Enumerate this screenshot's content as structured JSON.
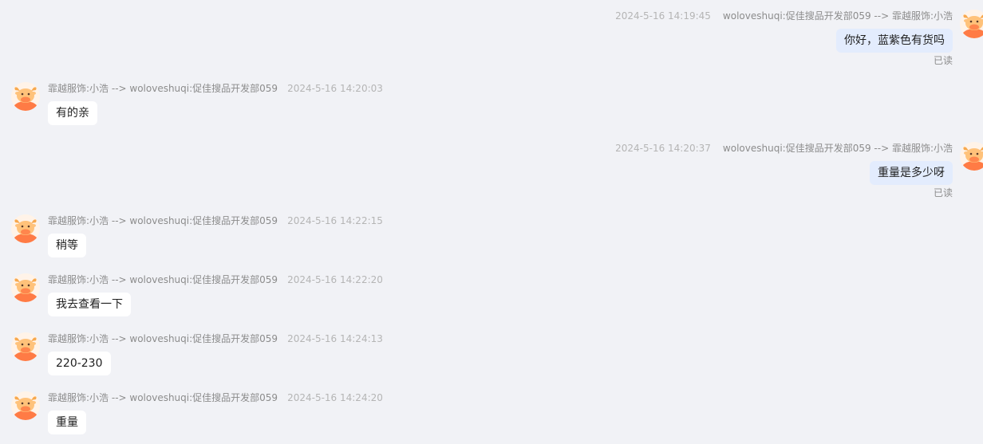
{
  "conversation": {
    "messages": [
      {
        "side": "right",
        "timestamp": "2024-5-16 14:19:45",
        "route": "woloveshuqi:促佳搜品开发部059 --> 霏越服饰:小浩",
        "text": "你好，蓝紫色有货吗",
        "status": "已读"
      },
      {
        "side": "left",
        "route": "霏越服饰:小浩 --> woloveshuqi:促佳搜品开发部059",
        "timestamp": "2024-5-16 14:20:03",
        "text": "有的亲"
      },
      {
        "side": "right",
        "timestamp": "2024-5-16 14:20:37",
        "route": "woloveshuqi:促佳搜品开发部059 --> 霏越服饰:小浩",
        "text": "重量是多少呀",
        "status": "已读"
      },
      {
        "side": "left",
        "route": "霏越服饰:小浩 --> woloveshuqi:促佳搜品开发部059",
        "timestamp": "2024-5-16 14:22:15",
        "text": "稍等"
      },
      {
        "side": "left",
        "route": "霏越服饰:小浩 --> woloveshuqi:促佳搜品开发部059",
        "timestamp": "2024-5-16 14:22:20",
        "text": "我去查看一下"
      },
      {
        "side": "left",
        "route": "霏越服饰:小浩 --> woloveshuqi:促佳搜品开发部059",
        "timestamp": "2024-5-16 14:24:13",
        "text": "220-230"
      },
      {
        "side": "left",
        "route": "霏越服饰:小浩 --> woloveshuqi:促佳搜品开发部059",
        "timestamp": "2024-5-16 14:24:20",
        "text": "重量"
      }
    ]
  },
  "avatar": {
    "icon": "bull-mascot-icon",
    "colors": {
      "background": "#fff3e8",
      "body": "#ff7b45",
      "face": "#ffc27a",
      "horns": "#f7a94f"
    }
  },
  "colors": {
    "page_background": "#f1f2f6",
    "sent_bubble": "#e3ecfd",
    "received_bubble": "#ffffff"
  }
}
